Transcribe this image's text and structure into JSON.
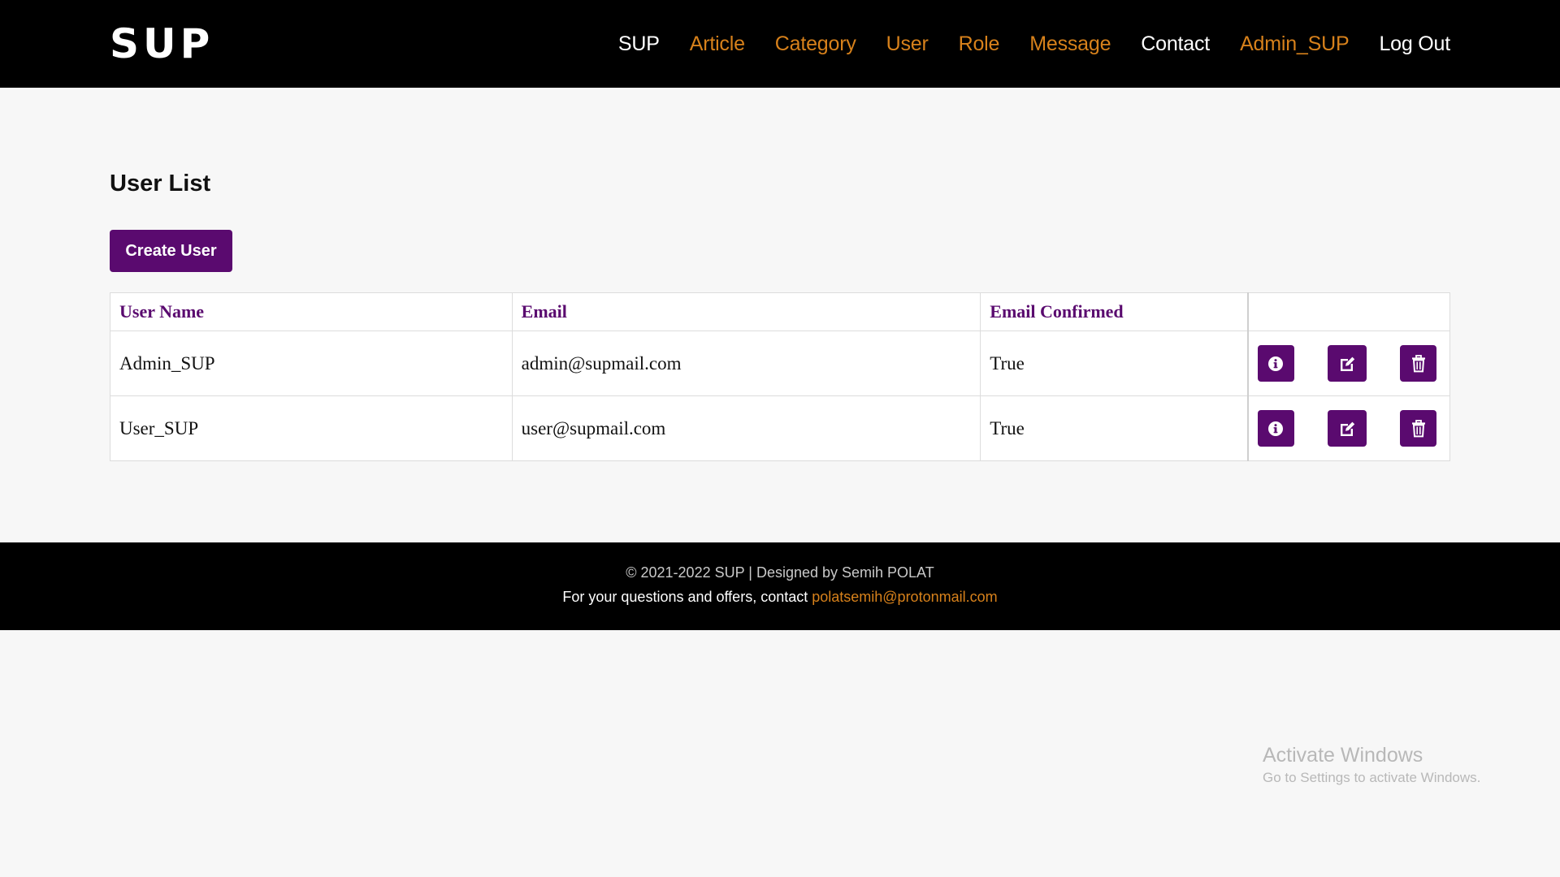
{
  "header": {
    "brand": "SUP",
    "nav": [
      {
        "label": "SUP",
        "style": "white"
      },
      {
        "label": "Article",
        "style": "accent"
      },
      {
        "label": "Category",
        "style": "accent"
      },
      {
        "label": "User",
        "style": "accent"
      },
      {
        "label": "Role",
        "style": "accent"
      },
      {
        "label": "Message",
        "style": "accent"
      },
      {
        "label": "Contact",
        "style": "white"
      },
      {
        "label": "Admin_SUP",
        "style": "accent"
      },
      {
        "label": "Log Out",
        "style": "white"
      }
    ]
  },
  "main": {
    "title": "User List",
    "create_button": "Create User",
    "table": {
      "columns": [
        "User Name",
        "Email",
        "Email Confirmed",
        ""
      ],
      "rows": [
        {
          "user_name": "Admin_SUP",
          "email": "admin@supmail.com",
          "email_confirmed": "True",
          "actions": [
            "info-icon",
            "edit-icon",
            "trash-icon"
          ]
        },
        {
          "user_name": "User_SUP",
          "email": "user@supmail.com",
          "email_confirmed": "True",
          "actions": [
            "info-icon",
            "edit-icon",
            "trash-icon"
          ]
        }
      ]
    }
  },
  "footer": {
    "copyright": "© 2021-2022 SUP | Designed by Semih POLAT",
    "contact_prefix": "For your questions and offers, contact ",
    "contact_email": "polatsemih@protonmail.com"
  },
  "watermark": {
    "title": "Activate Windows",
    "subtitle": "Go to Settings to activate Windows."
  },
  "colors": {
    "header_bg": "#000000",
    "accent_orange": "#d7811b",
    "brand_purple": "#5a0a6f",
    "page_bg": "#f7f7f7"
  }
}
